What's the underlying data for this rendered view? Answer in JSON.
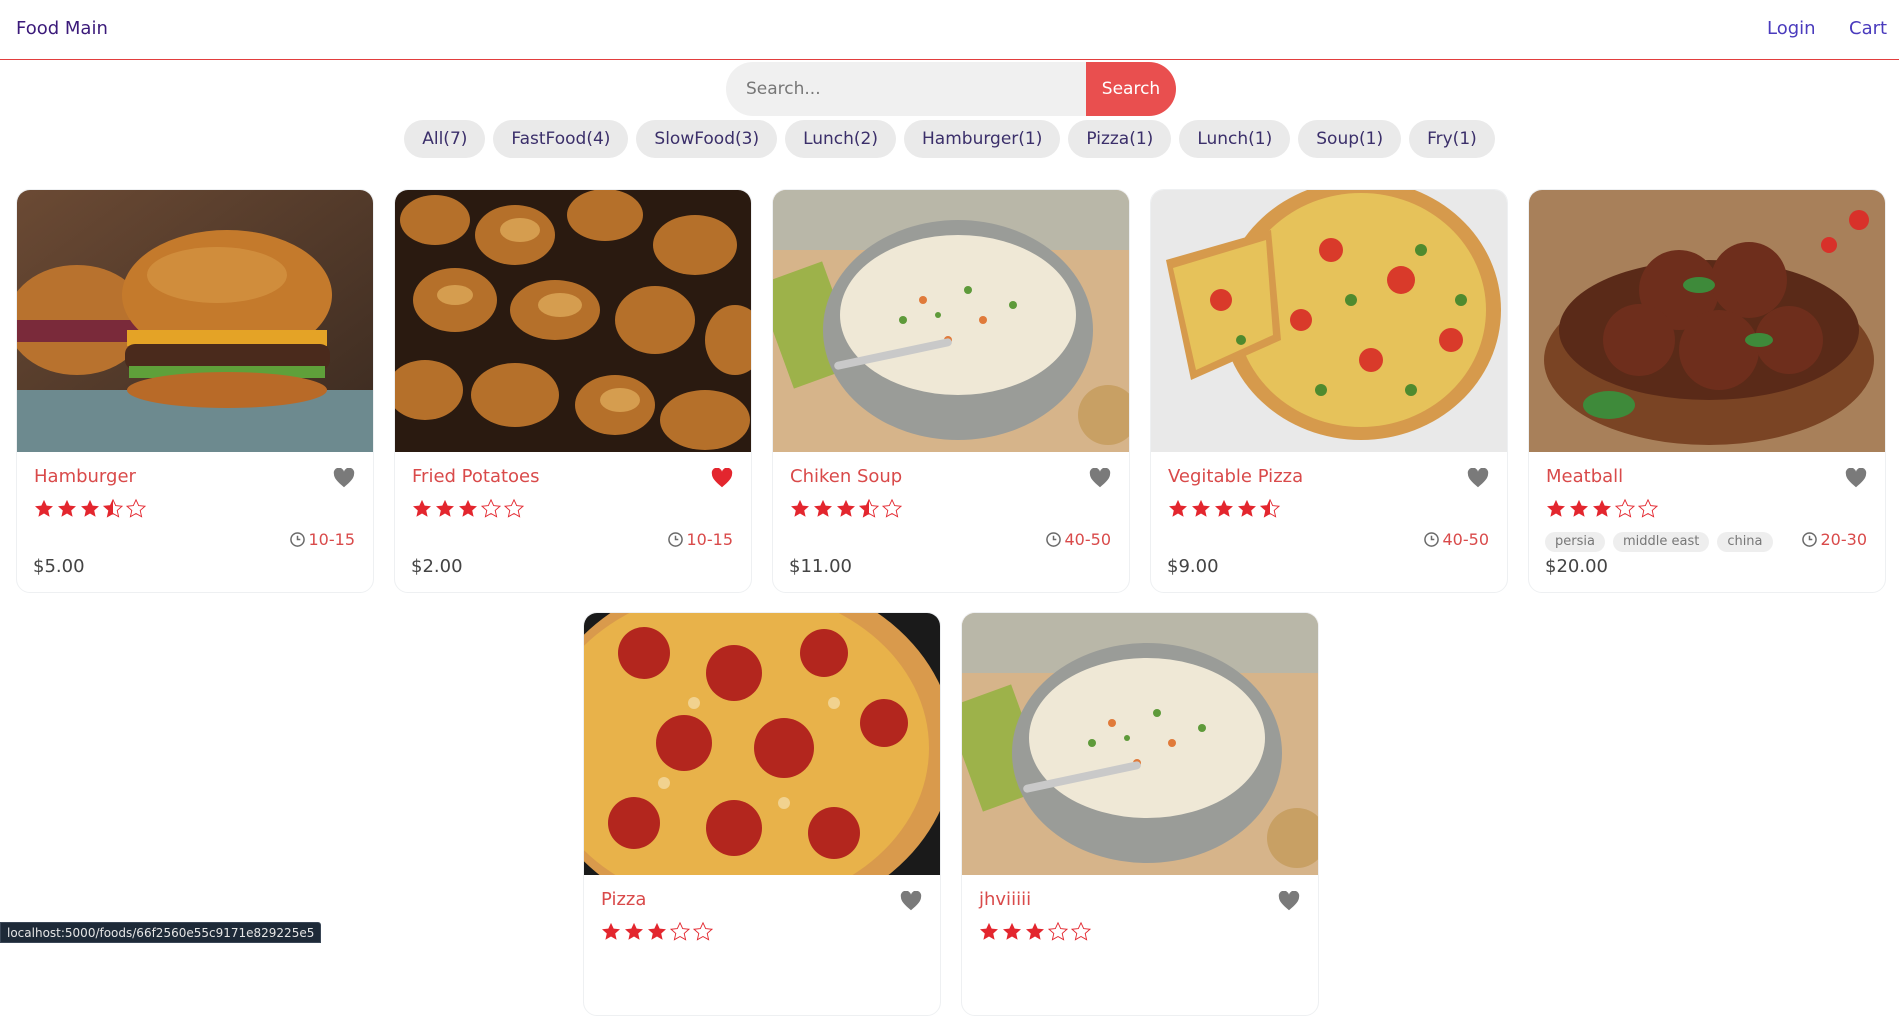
{
  "header": {
    "brand": "Food Main",
    "nav": {
      "login": "Login",
      "cart": "Cart"
    }
  },
  "search": {
    "placeholder": "Search...",
    "button_label": "Search"
  },
  "tags": [
    "All(7)",
    "FastFood(4)",
    "SlowFood(3)",
    "Lunch(2)",
    "Hamburger(1)",
    "Pizza(1)",
    "Lunch(1)",
    "Soup(1)",
    "Fry(1)"
  ],
  "foods": [
    {
      "name": "Hamburger",
      "rating": 3.5,
      "favorite": false,
      "time": "10-15",
      "price": "$5.00",
      "origins": [],
      "image": "hamburger"
    },
    {
      "name": "Fried Potatoes",
      "rating": 3,
      "favorite": true,
      "time": "10-15",
      "price": "$2.00",
      "origins": [],
      "image": "potatoes"
    },
    {
      "name": "Chiken Soup",
      "rating": 3.5,
      "favorite": false,
      "time": "40-50",
      "price": "$11.00",
      "origins": [],
      "image": "soup"
    },
    {
      "name": "Vegitable Pizza",
      "rating": 4.5,
      "favorite": false,
      "time": "40-50",
      "price": "$9.00",
      "origins": [],
      "image": "veg-pizza"
    },
    {
      "name": "Meatball",
      "rating": 3,
      "favorite": false,
      "time": "20-30",
      "price": "$20.00",
      "origins": [
        "persia",
        "middle east",
        "china"
      ],
      "image": "meatball"
    },
    {
      "name": "Pizza",
      "rating": 3,
      "favorite": false,
      "time": "",
      "price": "",
      "origins": [],
      "image": "pizza"
    },
    {
      "name": "jhviiiii",
      "rating": 3,
      "favorite": false,
      "time": "",
      "price": "",
      "origins": [],
      "image": "soup"
    }
  ],
  "status_url": "localhost:5000/foods/66f2560e55c9171e829225e5",
  "colors": {
    "accent": "#e94f4f",
    "star": "#e3262e",
    "heart_off": "#7a7a7a",
    "heart_on": "#e3262e"
  }
}
